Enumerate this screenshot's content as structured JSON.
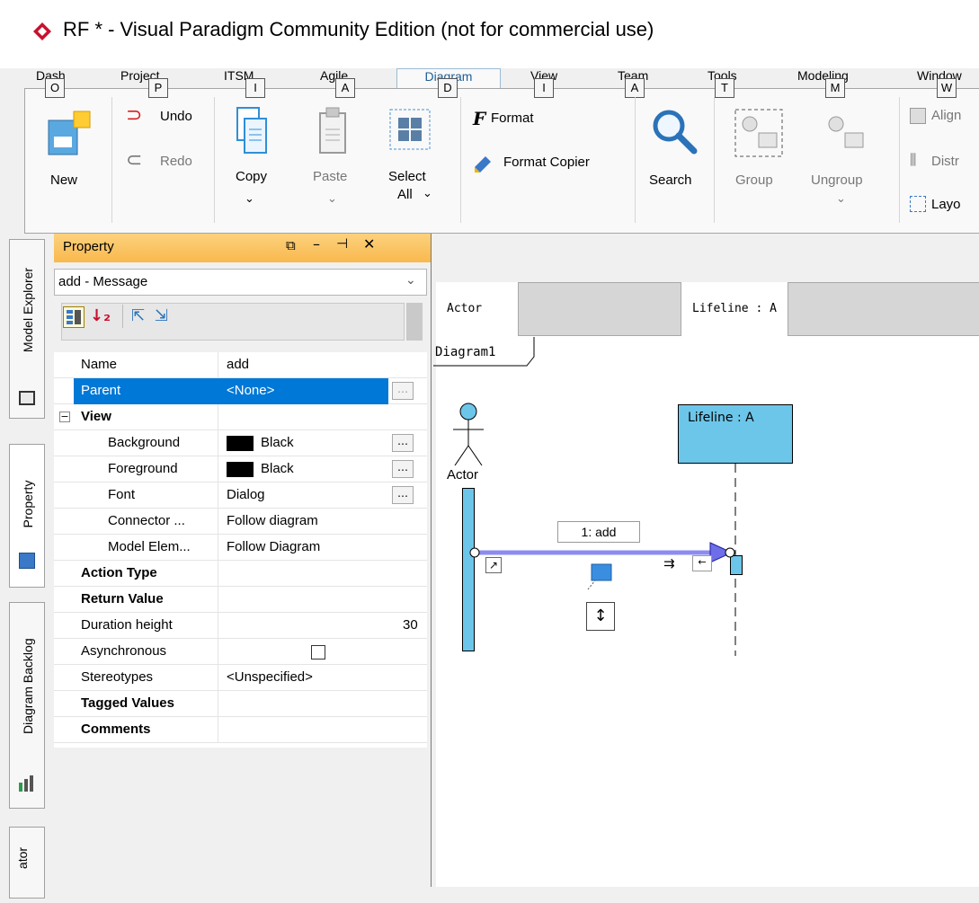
{
  "window": {
    "title": "RF * - Visual Paradigm Community Edition (not for commercial use)"
  },
  "ribbon": {
    "tabs": [
      {
        "label": "Dash",
        "keytip": "O"
      },
      {
        "label": "Project",
        "keytip": "P"
      },
      {
        "label": "ITSM",
        "keytip": "I"
      },
      {
        "label": "Agile",
        "keytip": "A"
      },
      {
        "label": "Diagram",
        "keytip": "D",
        "active": true
      },
      {
        "label": "View",
        "keytip": "I"
      },
      {
        "label": "Team",
        "keytip": "A"
      },
      {
        "label": "Tools",
        "keytip": "T"
      },
      {
        "label": "Modeling",
        "keytip": "M"
      },
      {
        "label": "Window",
        "keytip": "W"
      }
    ],
    "buttons": {
      "new": "New",
      "undo": "Undo",
      "redo": "Redo",
      "copy": "Copy",
      "paste": "Paste",
      "select_all_line1": "Select",
      "select_all_line2": "All",
      "format": "Format",
      "format_copier": "Format Copier",
      "search": "Search",
      "group": "Group",
      "ungroup": "Ungroup",
      "align": "Align",
      "distribute": "Distr",
      "layout": "Layo"
    }
  },
  "left_tabs": [
    "Model Explorer",
    "Property",
    "Diagram Backlog",
    "ator"
  ],
  "property_panel": {
    "title": "Property",
    "selected": "add - Message",
    "rows": [
      {
        "name": "Name",
        "value": "add"
      },
      {
        "name": "Parent",
        "value": "<None>",
        "selected": true
      },
      {
        "name": "View",
        "value": "",
        "group": true
      },
      {
        "name": "Background",
        "value": "Black",
        "swatch": "#000000"
      },
      {
        "name": "Foreground",
        "value": "Black",
        "swatch": "#000000"
      },
      {
        "name": "Font",
        "value": "Dialog"
      },
      {
        "name": "Connector ...",
        "value": "Follow diagram"
      },
      {
        "name": "Model Elem...",
        "value": "Follow Diagram"
      },
      {
        "name": "Action Type",
        "value": "",
        "bold": true
      },
      {
        "name": "Return Value",
        "value": "",
        "bold": true
      },
      {
        "name": "Duration height",
        "value": "30"
      },
      {
        "name": "Asynchronous",
        "value": ""
      },
      {
        "name": "Stereotypes",
        "value": "<Unspecified>"
      },
      {
        "name": "Tagged Values",
        "value": "",
        "bold": true
      },
      {
        "name": "Comments",
        "value": "",
        "bold": true
      }
    ]
  },
  "diagram": {
    "lane_headers": [
      "Actor",
      "Lifeline : A"
    ],
    "tab": "Diagram1",
    "actor_label": "Actor",
    "lifeline_label": "Lifeline : A",
    "message_label": "1: add",
    "colors": {
      "lifeline_fill": "#6cc6ea",
      "message": "#8c8cf0",
      "selection": "#0078d7",
      "prop_header": "#f9b84d"
    }
  }
}
